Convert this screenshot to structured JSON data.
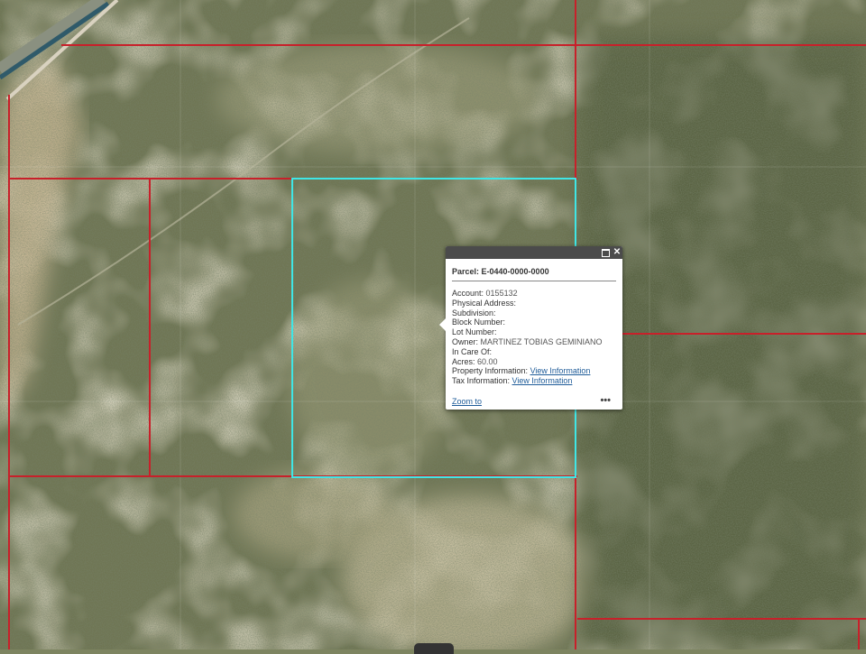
{
  "popup": {
    "title": "Parcel: E-0440-0000-0000",
    "fields": [
      {
        "label": "Account:",
        "value": "0155132"
      },
      {
        "label": "Physical Address:",
        "value": ""
      },
      {
        "label": "Subdivision:",
        "value": ""
      },
      {
        "label": "Block Number:",
        "value": ""
      },
      {
        "label": "Lot Number:",
        "value": ""
      },
      {
        "label": "Owner:",
        "value": "MARTINEZ TOBIAS GEMINIANO"
      },
      {
        "label": "In Care Of:",
        "value": ""
      },
      {
        "label": "Acres:",
        "value": "60.00"
      }
    ],
    "property_information_label": "Property Information:",
    "property_information_link": "View Information",
    "tax_information_label": "Tax Information:",
    "tax_information_link": "View Information",
    "zoom_to": "Zoom to",
    "more": "•••",
    "maximize_icon": "maximize-icon",
    "close_icon": "close-icon",
    "close_glyph": "✕"
  },
  "colors": {
    "parcel_line": "#c8202a",
    "selected_parcel": "#3fe6e6",
    "popup_titlebar": "#4b4b4b",
    "link": "#1f5c99"
  }
}
